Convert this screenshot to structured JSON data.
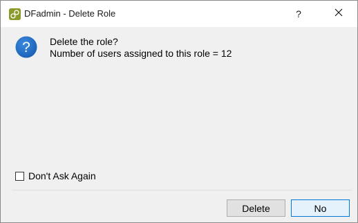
{
  "window": {
    "title": "DFadmin - Delete Role",
    "help_glyph": "?",
    "close_icon": "close-icon"
  },
  "message": {
    "line1": "Delete the role?",
    "line2": "Number of users assigned to this role = 12",
    "icon": "question-icon",
    "icon_color": "#1e6fc6"
  },
  "checkbox": {
    "label": "Don't Ask Again",
    "checked": false
  },
  "buttons": {
    "delete_label": "Delete",
    "no_label": "No",
    "default_accent": "#0078d7"
  }
}
